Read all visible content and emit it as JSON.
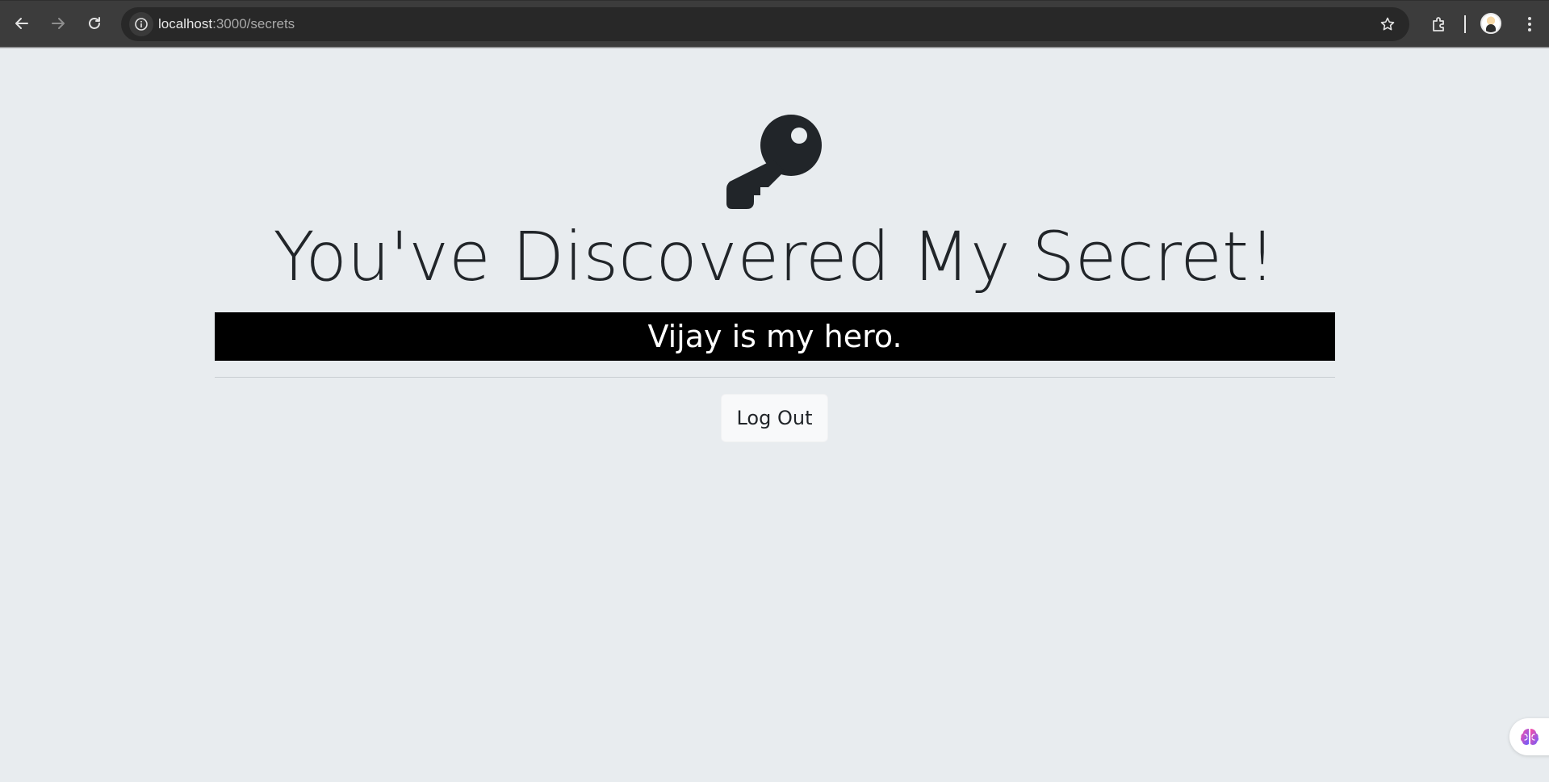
{
  "browser": {
    "url_host": "localhost",
    "url_path": ":3000/secrets"
  },
  "page": {
    "heading": "You've Discovered My Secret!",
    "secret": "Vijay is my hero.",
    "logout_label": "Log Out"
  },
  "icons": {
    "main": "key-icon",
    "assistant": "brain-icon"
  },
  "colors": {
    "background": "#e8ecef",
    "secret_bar": "#000000",
    "text": "#212529"
  }
}
